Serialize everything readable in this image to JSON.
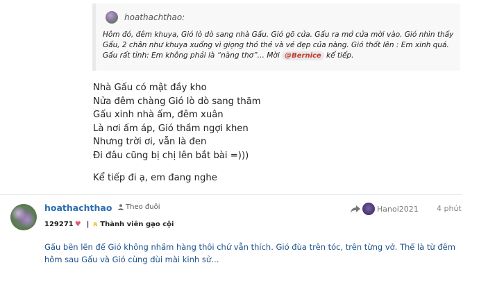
{
  "quote": {
    "username": "hoathachthao:",
    "text_before_mention": "Hôm đó, đêm khuya, Gió lò dò sang nhà Gấu. Gió gõ cửa. Gấu ra mở cửa mời vào. Gió nhìn thấy Gấu, 2 chân như khuya xuống vì giọng thỏ thẻ và vẻ đẹp của nàng. Gió thốt lên : Em xinh quá. Gấu rất tỉnh: Em không phải là “nàng thơ”… Mời",
    "mention": "@Bernice",
    "text_after_mention": "kể tiếp."
  },
  "poem": {
    "lines": [
      "Nhà Gấu có mật đầy kho",
      "Nửa đêm chàng Gió lò dò sang thăm",
      "Gấu xinh nhà ấm, đêm xuân",
      "Là nơi ấm áp, Gió thầm ngợi khen",
      "Nhưng trời ơi, vẫn là đen",
      "Đi đâu cũng bị chị lên bắt bài =)))"
    ],
    "closing": "Kể tiếp đi ạ, em đang nghe"
  },
  "post": {
    "username": "hoathachthao",
    "follow_label": "Theo đuôi",
    "likes_count": "129271",
    "heart_icon": "♥",
    "separator": "|",
    "badge_title": "Thành viên gạo cội",
    "reply_to_user": "Hanoi2021",
    "time": "4 phút",
    "text": "Gấu bẽn lẽn để Gió không nhầm hàng thôi chứ vẫn thích. Gió đùa trên tóc, trên từng vở. Thế là từ đêm hôm sau Gấu và Gió cùng dùi mài kinh sử…"
  },
  "colors": {
    "username_blue": "#2a6db0",
    "post_text_blue": "#1a4f8a",
    "mention_red": "#c0392b",
    "heart_pink": "#e05a7a",
    "badge_gold": "#e6b800"
  }
}
